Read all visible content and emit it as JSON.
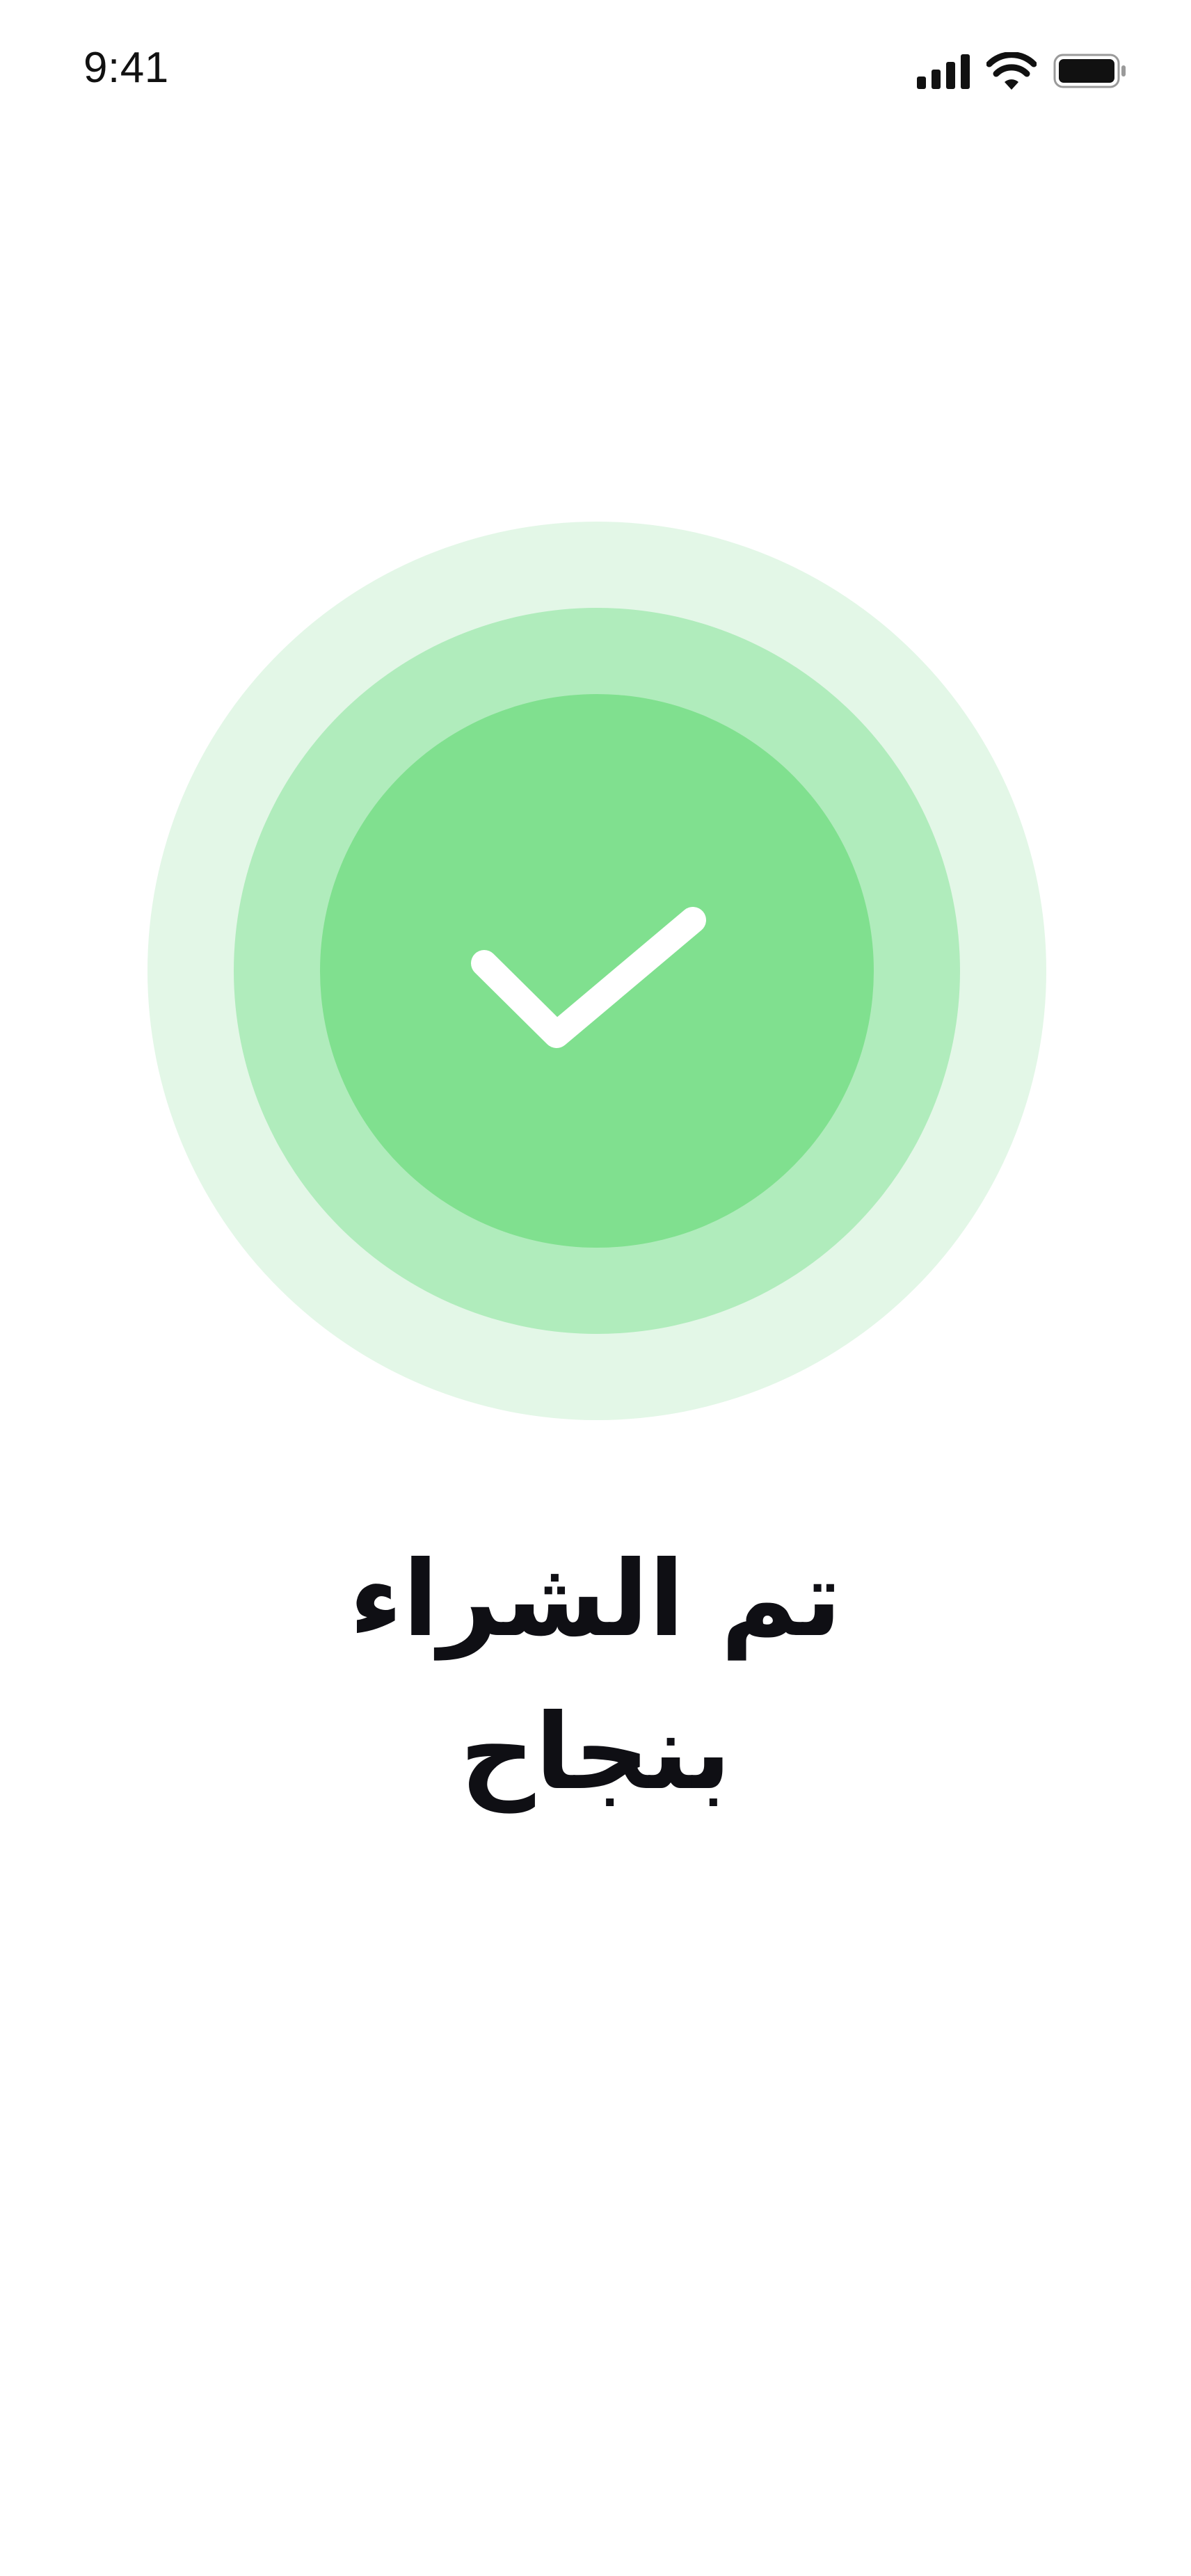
{
  "status_bar": {
    "time": "9:41",
    "icons": [
      "cellular-signal-icon",
      "wifi-icon",
      "battery-icon"
    ]
  },
  "success": {
    "icon": "checkmark-icon",
    "colors": {
      "ring_outer": "#e3f7e7",
      "ring_middle": "#b0ecbc",
      "ring_inner": "#80e08f",
      "check": "#ffffff"
    },
    "title_line1": "تم الشراء",
    "title_line2": "بنجاح"
  }
}
